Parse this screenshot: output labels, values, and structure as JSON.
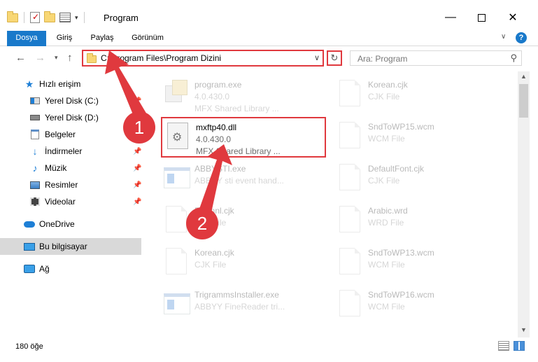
{
  "window": {
    "title": "Program",
    "minimize_glyph": "—",
    "close_glyph": "✕"
  },
  "ribbon": {
    "file_tab": "Dosya",
    "tabs": [
      "Giriş",
      "Paylaş",
      "Görünüm"
    ],
    "help": "?"
  },
  "nav": {
    "address": "C:\\Program Files\\Program Dizini",
    "search_placeholder": "Ara: Program"
  },
  "sidebar": {
    "items": [
      {
        "label": "Hızlı erişim",
        "icon": "star-icon"
      },
      {
        "label": "Yerel Disk (C:)",
        "icon": "drive-icon",
        "pinned": true
      },
      {
        "label": "Yerel Disk (D:)",
        "icon": "drive-icon"
      },
      {
        "label": "Belgeler",
        "icon": "documents-icon"
      },
      {
        "label": "İndirmeler",
        "icon": "download-icon",
        "pinned": true
      },
      {
        "label": "Müzik",
        "icon": "music-icon",
        "pinned": true
      },
      {
        "label": "Resimler",
        "icon": "pictures-icon",
        "pinned": true
      },
      {
        "label": "Videolar",
        "icon": "videos-icon",
        "pinned": true
      },
      {
        "label": "OneDrive",
        "icon": "cloud-icon"
      },
      {
        "label": "Bu bilgisayar",
        "icon": "computer-icon",
        "selected": true
      },
      {
        "label": "Ağ",
        "icon": "network-icon"
      }
    ]
  },
  "files": {
    "col1": [
      {
        "name": "program.exe",
        "line2": "4.0.430.0",
        "line3": "MFX Shared Library ...",
        "icon": "exe-icon",
        "faded": true
      },
      {
        "name": "mxftp40.dll",
        "line2": "4.0.430.0",
        "line3": "MFX Shared Library ...",
        "icon": "dll-gear-icon",
        "faded": false,
        "highlighted": true
      },
      {
        "name": "ABBYSTI.exe",
        "line2": "ABBYY sti event hand...",
        "line3": "",
        "icon": "app-icon",
        "faded": true
      },
      {
        "name": "FoNnnl.cjk",
        "line2": "CJK File",
        "line3": "",
        "icon": "blank-file-icon",
        "faded": true
      },
      {
        "name": "Korean.cjk",
        "line2": "CJK File",
        "line3": "",
        "icon": "blank-file-icon",
        "faded": true
      },
      {
        "name": "TrigrammsInstaller.exe",
        "line2": "ABBYY FineReader tri...",
        "line3": "",
        "icon": "app-icon",
        "faded": true
      }
    ],
    "col2": [
      {
        "name": "Korean.cjk",
        "line2": "CJK File",
        "icon": "blank-file-icon"
      },
      {
        "name": "SndToWP15.wcm",
        "line2": "WCM File",
        "icon": "blank-file-icon"
      },
      {
        "name": "DefaultFont.cjk",
        "line2": "CJK File",
        "icon": "blank-file-icon"
      },
      {
        "name": "Arabic.wrd",
        "line2": "WRD File",
        "icon": "blank-file-icon"
      },
      {
        "name": "SndToWP13.wcm",
        "line2": "WCM File",
        "icon": "blank-file-icon"
      },
      {
        "name": "SndToWP16.wcm",
        "line2": "WCM File",
        "icon": "blank-file-icon"
      }
    ]
  },
  "status": {
    "item_count": "180 öğe"
  },
  "annotations": {
    "badge1": "1",
    "badge2": "2",
    "color": "#e0393e"
  }
}
